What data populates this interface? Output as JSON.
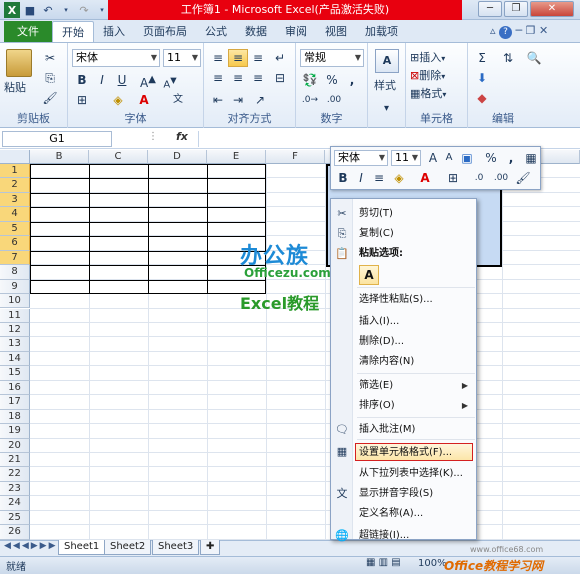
{
  "title": "工作簿1 - Microsoft Excel(产品激活失败)",
  "ribbon_tabs": [
    "文件",
    "开始",
    "插入",
    "页面布局",
    "公式",
    "数据",
    "审阅",
    "视图",
    "加载项"
  ],
  "groups": {
    "clipboard": {
      "label": "剪贴板",
      "paste": "粘贴"
    },
    "font": {
      "label": "字体",
      "font_name": "宋体",
      "font_size": "11"
    },
    "alignment": {
      "label": "对齐方式"
    },
    "number": {
      "label": "数字",
      "format": "常规"
    },
    "styles": {
      "label": "样式",
      "button": "样式"
    },
    "cells": {
      "label": "单元格",
      "insert": "插入",
      "delete": "删除",
      "format": "格式"
    },
    "editing": {
      "label": "编辑"
    }
  },
  "formula_bar": {
    "name_box": "G1",
    "fx": "fx",
    "value": ""
  },
  "columns": [
    "B",
    "C",
    "D",
    "E",
    "F"
  ],
  "rows": [
    "1",
    "2",
    "3",
    "4",
    "5",
    "6",
    "7",
    "8",
    "9",
    "10",
    "11",
    "12",
    "13",
    "14",
    "15",
    "16",
    "17",
    "18",
    "19",
    "20",
    "21",
    "22",
    "23",
    "24",
    "25",
    "26"
  ],
  "mini_toolbar": {
    "font": "宋体",
    "size": "11"
  },
  "context_menu": [
    {
      "label": "剪切(T)",
      "icon": "scissors-icon"
    },
    {
      "label": "复制(C)",
      "icon": "copy-icon"
    },
    {
      "label": "粘贴选项:",
      "icon": "paste-icon",
      "bold": true
    },
    {
      "label": "A",
      "icon": "",
      "paste_option": true
    },
    {
      "label": "选择性粘贴(S)...",
      "icon": ""
    },
    {
      "label": "插入(I)...",
      "icon": ""
    },
    {
      "label": "删除(D)...",
      "icon": ""
    },
    {
      "label": "清除内容(N)",
      "icon": ""
    },
    {
      "label": "筛选(E)",
      "icon": "",
      "submenu": true
    },
    {
      "label": "排序(O)",
      "icon": "",
      "submenu": true
    },
    {
      "label": "插入批注(M)",
      "icon": "comment-icon"
    },
    {
      "label": "设置单元格格式(F)...",
      "icon": "format-cells-icon",
      "highlight": true
    },
    {
      "label": "从下拉列表中选择(K)...",
      "icon": ""
    },
    {
      "label": "显示拼音字段(S)",
      "icon": "phonetic-icon"
    },
    {
      "label": "定义名称(A)...",
      "icon": ""
    },
    {
      "label": "超链接(I)...",
      "icon": "hyperlink-icon"
    }
  ],
  "sheets": [
    "Sheet1",
    "Sheet2",
    "Sheet3"
  ],
  "status": {
    "ready": "就绪",
    "zoom": "100%"
  },
  "watermark": {
    "line1": "办公族",
    "line2": "Officezu.com",
    "line3": "Excel教程",
    "footer": "Office教程学习网",
    "footer_url": "www.office68.com"
  }
}
